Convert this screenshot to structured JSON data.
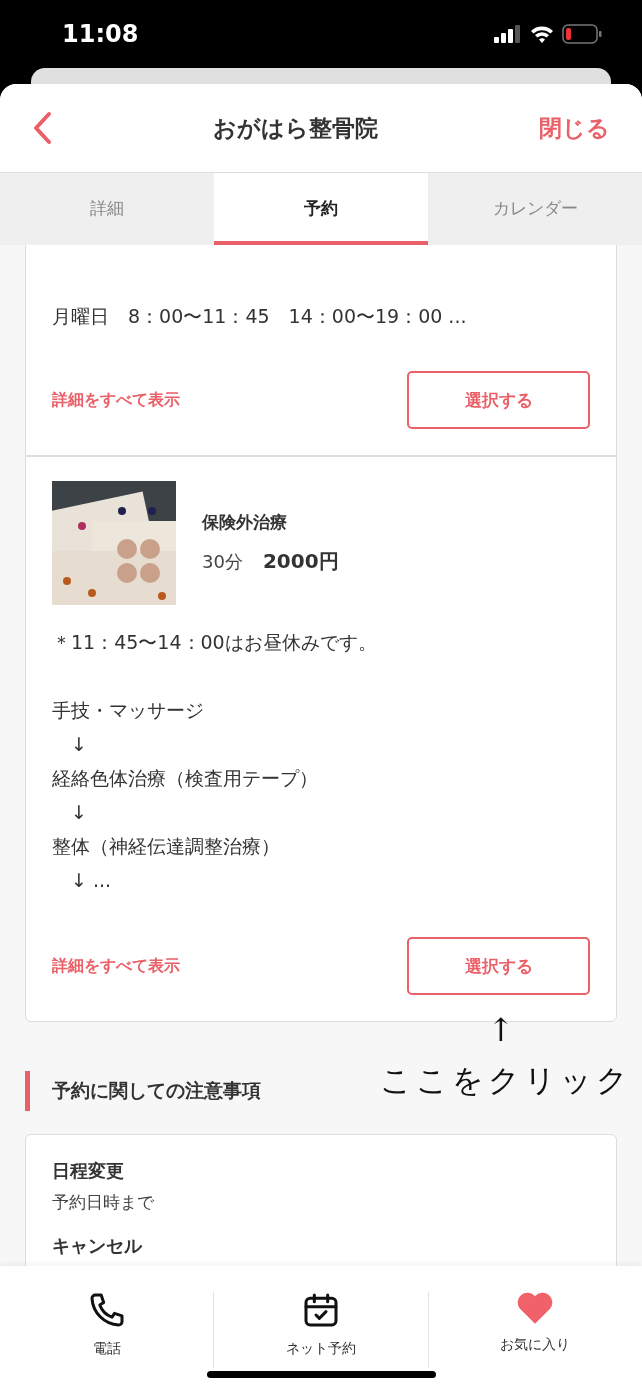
{
  "status_bar": {
    "time": "11:08"
  },
  "header": {
    "title": "おがはら整骨院",
    "close": "閉じる"
  },
  "tabs": [
    {
      "label": "詳細",
      "selected": false
    },
    {
      "label": "予約",
      "selected": true
    },
    {
      "label": "カレンダー",
      "selected": false
    }
  ],
  "menus": [
    {
      "lines": [
        "月曜日　8：00〜11：45　14：00〜19：00 ..."
      ],
      "more_link": "詳細をすべて表示",
      "select_button": "選択する"
    },
    {
      "name": "保険外治療",
      "duration": "30分",
      "price": "2000円",
      "note": "＊11：45〜14：00はお昼休みです。",
      "lines": [
        "手技・マッサージ",
        "　↓",
        "経絡色体治療（検査用テープ）",
        "　↓",
        "整体（神経伝達調整治療）",
        "　↓ ..."
      ],
      "more_link": "詳細をすべて表示",
      "select_button": "選択する"
    }
  ],
  "annotation": {
    "arrow": "↑",
    "text": "ここをクリック"
  },
  "notes": {
    "heading": "予約に関しての注意事項",
    "items": [
      {
        "label": "日程変更",
        "value": "予約日時まで"
      },
      {
        "label": "キャンセル"
      }
    ]
  },
  "bottom_nav": [
    {
      "label": "電話"
    },
    {
      "label": "ネット予約"
    },
    {
      "label": "お気に入り"
    }
  ]
}
